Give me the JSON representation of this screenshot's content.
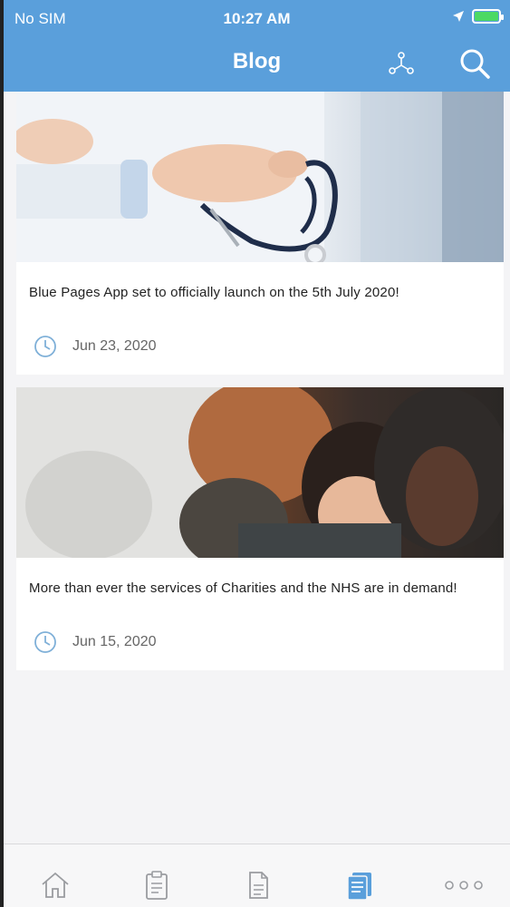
{
  "status_bar": {
    "carrier": "No SIM",
    "time": "10:27 AM",
    "battery_level": 1.0
  },
  "nav": {
    "title": "Blog",
    "icons": [
      "share-icon",
      "search-icon"
    ]
  },
  "posts": [
    {
      "title": "Blue Pages App set to officially launch on the 5th July 2020!",
      "date": "Jun 23, 2020",
      "image": "doctor-stethoscope-photo"
    },
    {
      "title": "More than ever the services of Charities and the NHS are in demand!",
      "date": "Jun 15, 2020",
      "image": "mother-child-hug-photo"
    }
  ],
  "tabbar": {
    "items": [
      "home-icon",
      "clipboard-icon",
      "document-icon",
      "blog-icon",
      "more-icon"
    ],
    "active": "blog-icon"
  },
  "colors": {
    "primary": "#5a9fdb",
    "background": "#f4f4f6",
    "battery": "#4cd964"
  }
}
